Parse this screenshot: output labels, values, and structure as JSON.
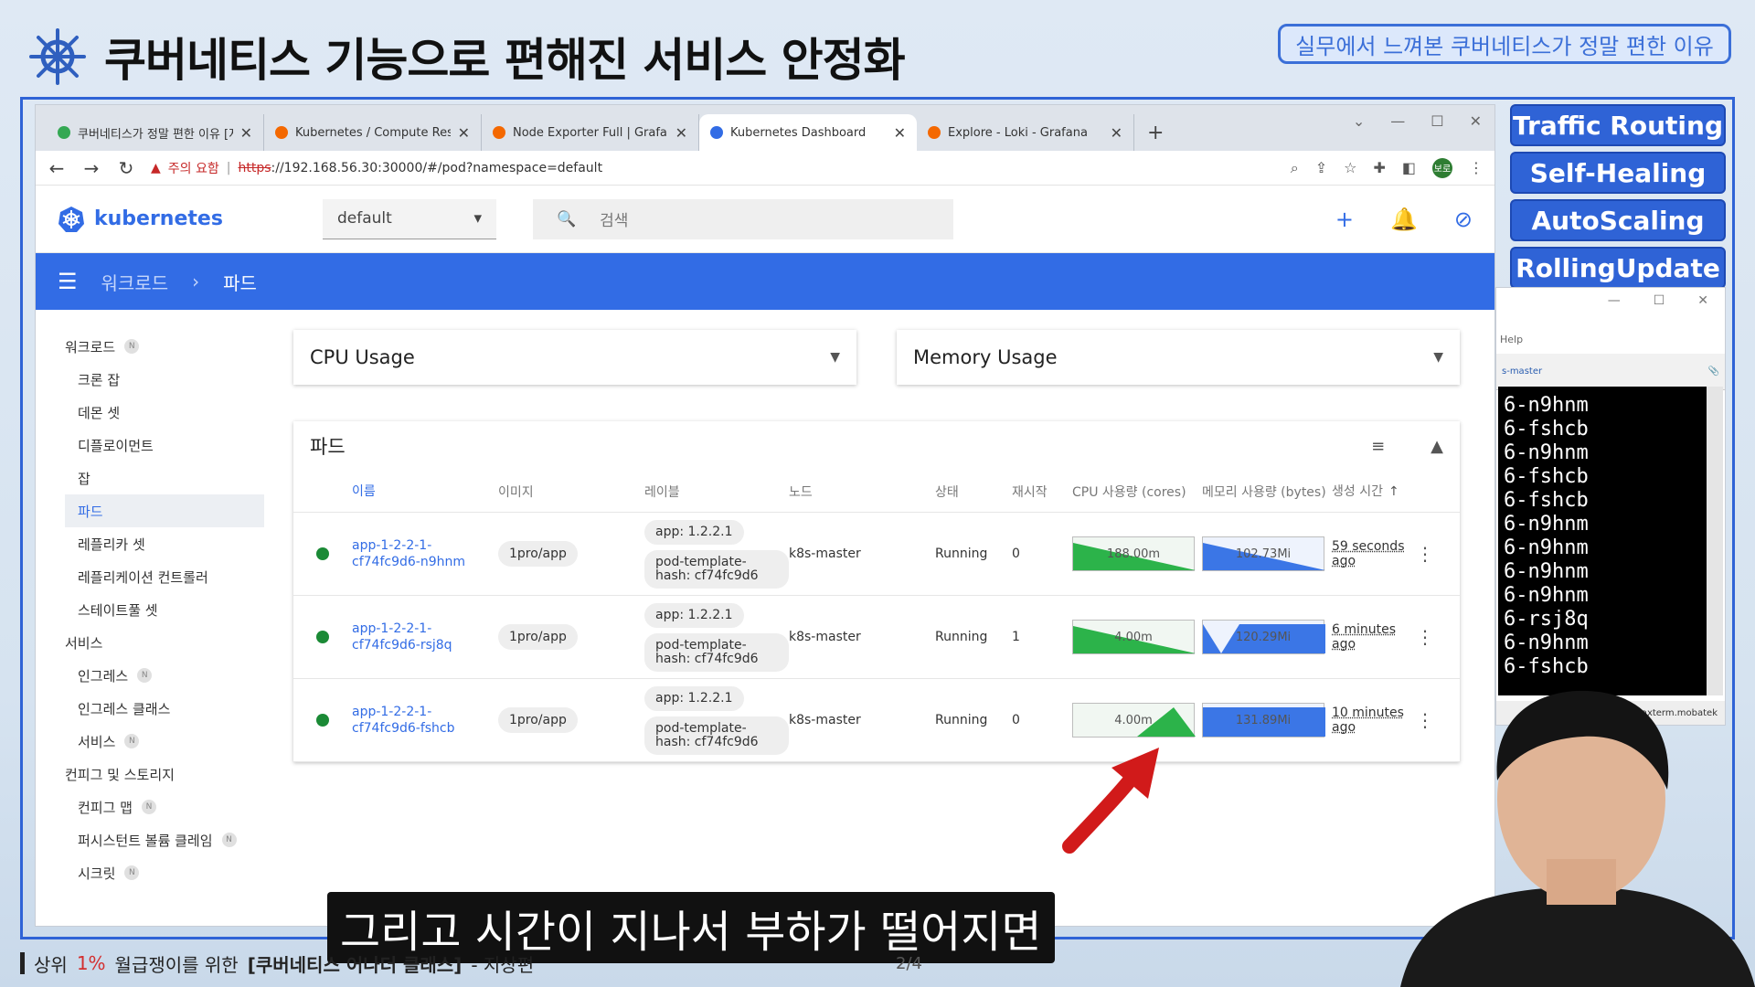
{
  "slide": {
    "title": "쿠버네티스 기능으로 편해진 서비스 안정화",
    "tag": "실무에서 느껴본 쿠버네티스가 정말 편한 이유",
    "features": [
      "Traffic Routing",
      "Self-Healing",
      "AutoScaling",
      "RollingUpdate"
    ],
    "caption": "그리고 시간이 지나서 부하가 떨어지면",
    "footer": {
      "prefix": "상위",
      "accent": "1%",
      "middle": "월급쟁이를 위한",
      "course": "[쿠버네티스 어나더 클래스]",
      "author": "- 지상편"
    },
    "page_no": "2/4"
  },
  "browser": {
    "tabs": [
      {
        "label": "쿠버네티스가 정말 편한 이유 [지",
        "color": "#34a853"
      },
      {
        "label": "Kubernetes / Compute Resourc",
        "color": "#f46800"
      },
      {
        "label": "Node Exporter Full | Grafana La",
        "color": "#f46800"
      },
      {
        "label": "Kubernetes Dashboard",
        "color": "#326ce5"
      },
      {
        "label": "Explore - Loki - Grafana",
        "color": "#f46800"
      }
    ],
    "warning": "주의 요함",
    "url_scheme": "https",
    "url_rest": "://192.168.56.30:30000/#/pod?namespace=default",
    "profile": "보로"
  },
  "dashboard": {
    "brand": "kubernetes",
    "namespace": "default",
    "search_placeholder": "검색",
    "breadcrumb": {
      "parent": "워크로드",
      "current": "파드"
    },
    "sidebar": {
      "workloads": "워크로드",
      "workload_items": [
        "크론 잡",
        "데몬 셋",
        "디플로이먼트",
        "잡",
        "파드",
        "레플리카 셋",
        "레플리케이션 컨트롤러",
        "스테이트풀 셋"
      ],
      "services": "서비스",
      "service_items": [
        "인그레스",
        "인그레스 클래스",
        "서비스"
      ],
      "config": "컨피그 및 스토리지",
      "config_items": [
        "컨피그 맵",
        "퍼시스턴트 볼륨 클레임",
        "시크릿"
      ],
      "badge": "N"
    },
    "cpu_card": "CPU Usage",
    "mem_card": "Memory Usage",
    "pods_title": "파드",
    "columns": {
      "name": "이름",
      "image": "이미지",
      "labels": "레이블",
      "node": "노드",
      "status": "상태",
      "restarts": "재시작",
      "cpu": "CPU 사용량 (cores)",
      "mem": "메모리 사용량 (bytes)",
      "age": "생성 시간"
    },
    "pods": [
      {
        "name": "app-1-2-2-1-cf74fc9d6-n9hnm",
        "image": "1pro/app",
        "label1": "app: 1.2.2.1",
        "label2": "pod-template-hash: cf74fc9d6",
        "node": "k8s-master",
        "status": "Running",
        "restarts": "0",
        "cpu": "188.00m",
        "mem": "102.73Mi",
        "age": "59 seconds ago",
        "cpu_trend": "falling",
        "mem_trend": "falling"
      },
      {
        "name": "app-1-2-2-1-cf74fc9d6-rsj8q",
        "image": "1pro/app",
        "label1": "app: 1.2.2.1",
        "label2": "pod-template-hash: cf74fc9d6",
        "node": "k8s-master",
        "status": "Running",
        "restarts": "1",
        "cpu": "4.00m",
        "mem": "120.29Mi",
        "age": "6 minutes ago",
        "cpu_trend": "falling",
        "mem_trend": "dip"
      },
      {
        "name": "app-1-2-2-1-cf74fc9d6-fshcb",
        "image": "1pro/app",
        "label1": "app: 1.2.2.1",
        "label2": "pod-template-hash: cf74fc9d6",
        "node": "k8s-master",
        "status": "Running",
        "restarts": "0",
        "cpu": "4.00m",
        "mem": "131.89Mi",
        "age": "10 minutes ago",
        "cpu_trend": "rising",
        "mem_trend": "flat"
      }
    ]
  },
  "terminal": {
    "help": "Help",
    "tab": "s-master",
    "lines": [
      "6-n9hnm",
      "6-fshcb",
      "6-n9hnm",
      "6-fshcb",
      "6-fshcb",
      "6-n9hnm",
      "6-n9hnm",
      "6-n9hnm",
      "6-n9hnm",
      "6-rsj8q",
      "6-n9hnm",
      "6-fshcb"
    ],
    "footer": "mobaxterm.mobatek"
  },
  "colors": {
    "k8s_blue": "#326ce5",
    "feature_blue": "#2f63d6",
    "running_green": "#1b8a36",
    "cpu_green": "#2cb34a",
    "mem_blue": "#3b76e6"
  }
}
